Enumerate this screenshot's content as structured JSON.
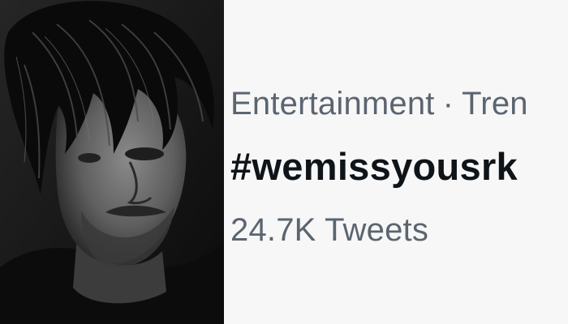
{
  "photo": {
    "subject_icon": "portrait-photo"
  },
  "trend": {
    "category": "Entertainment",
    "separator": "·",
    "context": "Tren",
    "hashtag": "#wemissyousrk",
    "count": "24.7K Tweets"
  },
  "colors": {
    "meta_text": "#5b6570",
    "hashtag_text": "#0f1419",
    "card_background": "#f7f7f7"
  }
}
